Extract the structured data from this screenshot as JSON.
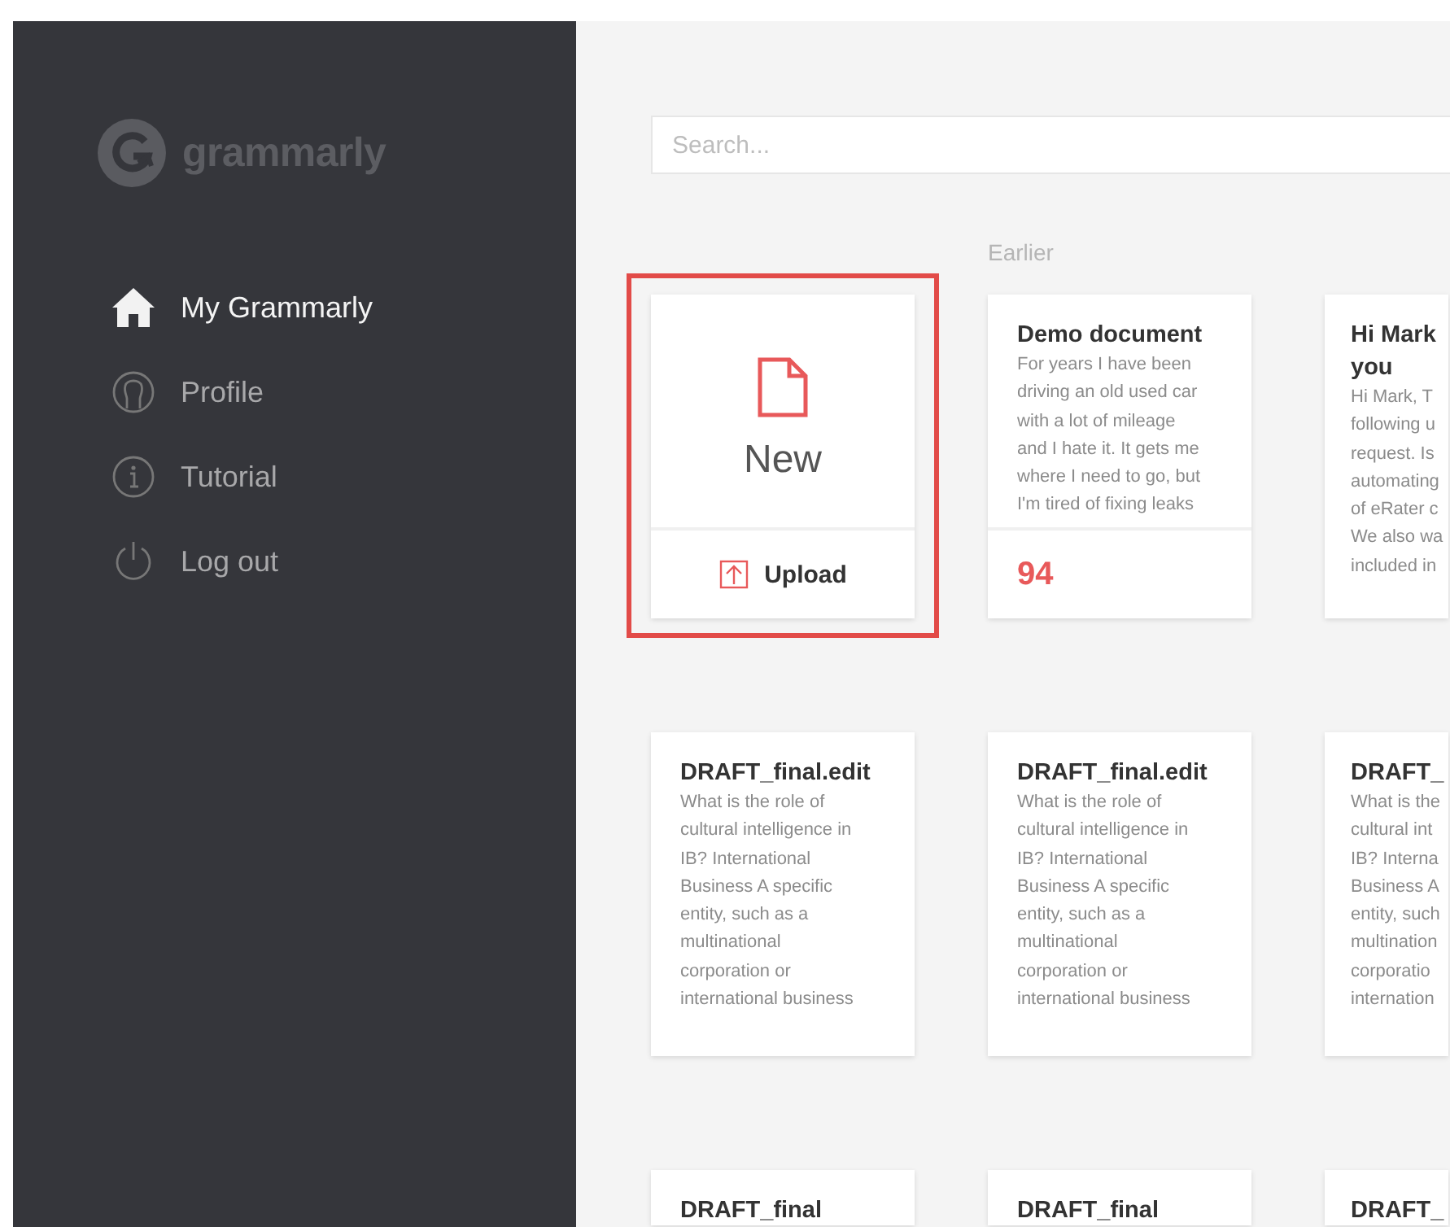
{
  "sidebar": {
    "logo": "grammarly",
    "items": [
      {
        "label": "My Grammarly",
        "selected": true
      },
      {
        "label": "Profile",
        "selected": false
      },
      {
        "label": "Tutorial",
        "selected": false
      },
      {
        "label": "Log out",
        "selected": false
      }
    ]
  },
  "search": {
    "placeholder": "Search..."
  },
  "section_label": "Earlier",
  "new_card": {
    "label": "New",
    "upload": "Upload",
    "highlighted": true
  },
  "documents": [
    {
      "title_lines": [
        "Demo document"
      ],
      "body_lines": [
        "For years I have been",
        "driving an old used car",
        "with a lot of mileage",
        "and I hate it. It gets me",
        "where I need to go, but",
        "I'm tired of fixing leaks"
      ],
      "score": "94"
    },
    {
      "title_lines": [
        "Hi Mark",
        "you"
      ],
      "body_lines": [
        "Hi Mark, T",
        "following u",
        "request. Is",
        "automating",
        "of eRater c",
        "We also wa",
        "included in"
      ]
    },
    {
      "title_lines": [
        "DRAFT_final.edit"
      ],
      "body_lines": [
        "What is the role of",
        "cultural intelligence in",
        "IB? International",
        "Business A specific",
        "entity, such as a",
        "multinational",
        "corporation or",
        "international business"
      ]
    },
    {
      "title_lines": [
        "DRAFT_final.edit"
      ],
      "body_lines": [
        "What is the role of",
        "cultural intelligence in",
        "IB? International",
        "Business A specific",
        "entity, such as a",
        "multinational",
        "corporation or",
        "international business"
      ]
    },
    {
      "title_lines": [
        "DRAFT_"
      ],
      "body_lines": [
        "What is the",
        "cultural int",
        "IB? Interna",
        "Business A",
        "entity, such",
        "multination",
        "corporatio",
        "internation"
      ]
    },
    {
      "title_lines": [
        "DRAFT_final"
      ]
    },
    {
      "title_lines": [
        "DRAFT_final"
      ]
    },
    {
      "title_lines": [
        "DRAFT_"
      ]
    }
  ]
}
